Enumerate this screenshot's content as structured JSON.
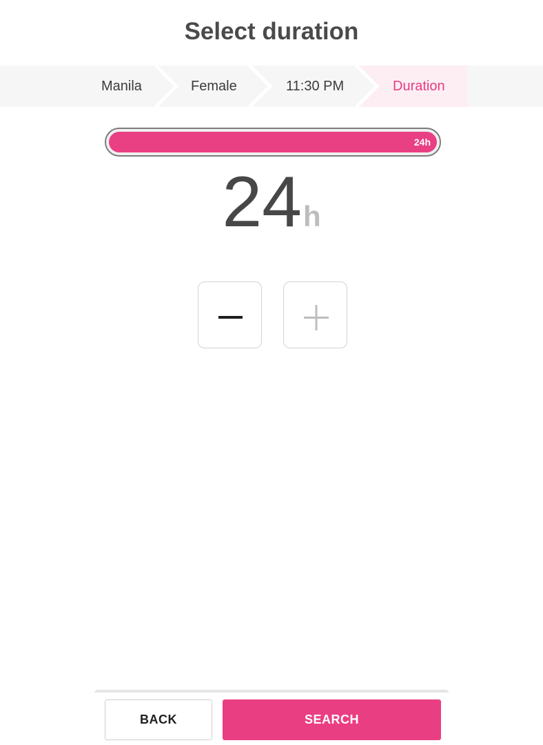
{
  "header": {
    "title": "Select duration"
  },
  "breadcrumb": {
    "items": [
      {
        "label": "Manila",
        "active": false
      },
      {
        "label": "Female",
        "active": false
      },
      {
        "label": "11:30 PM",
        "active": false
      },
      {
        "label": "Duration",
        "active": true
      }
    ]
  },
  "duration": {
    "value": "24",
    "unit": "h",
    "slider_label": "24h",
    "fill_fraction": 1.0
  },
  "stepper": {
    "decrement_icon": "minus-icon",
    "increment_icon": "plus-icon",
    "increment_disabled": true
  },
  "footer": {
    "back_label": "BACK",
    "search_label": "SEARCH"
  },
  "colors": {
    "accent": "#ea3e83",
    "active_crumb_bg": "#fdeef4",
    "text": "#4a4a4a",
    "disabled": "#bdbdbd"
  }
}
